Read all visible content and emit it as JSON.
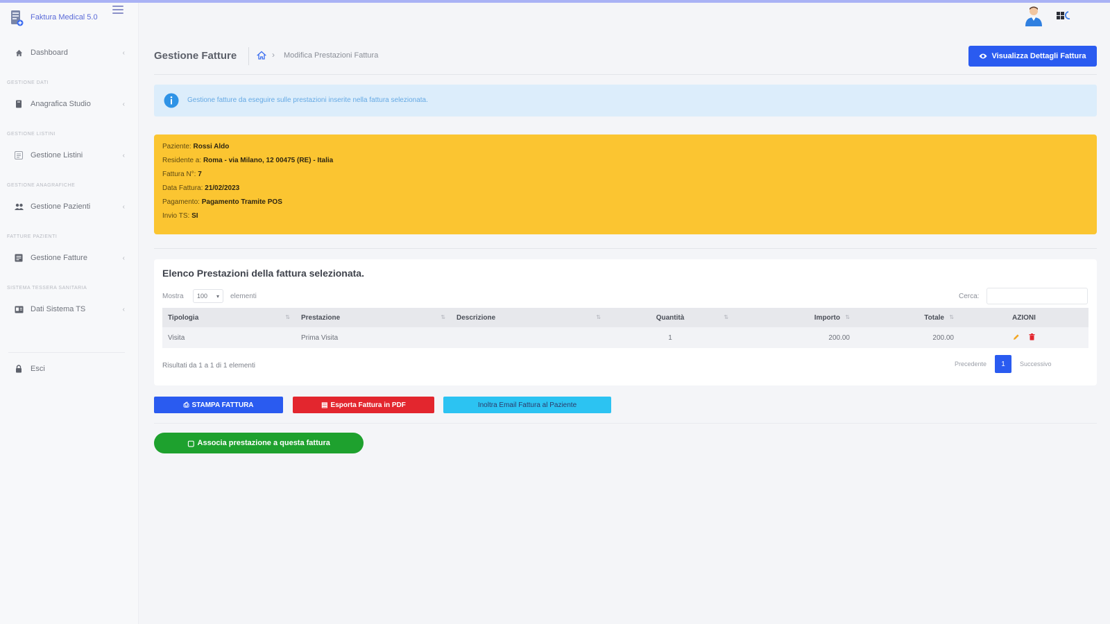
{
  "app": {
    "brand": "Faktura Medical 5.0"
  },
  "sidebar": {
    "dashboard": "Dashboard",
    "sections": [
      {
        "title": "Gestione Dati",
        "item": "Anagrafica Studio"
      },
      {
        "title": "Gestione Listini",
        "item": "Gestione Listini"
      },
      {
        "title": "Gestione Anagrafiche",
        "item": "Gestione Pazienti"
      },
      {
        "title": "Fatture Pazienti",
        "item": "Gestione Fatture"
      },
      {
        "title": "Sistema Tessera Sanitaria",
        "item": "Dati Sistema TS"
      }
    ],
    "exit": "Esci"
  },
  "header": {
    "page_title": "Gestione Fatture",
    "breadcrumb_current": "Modifica Prestazioni Fattura",
    "details_button": "Visualizza Dettagli Fattura"
  },
  "alert": {
    "text": "Gestione fatture da eseguire sulle prestazioni inserite nella fattura selezionata."
  },
  "invoice": {
    "patient_label": "Paziente:",
    "patient_value": "Rossi Aldo",
    "residence_label": "Residente a:",
    "residence_value": "Roma - via Milano, 12 00475 (RE) - Italia",
    "number_label": "Fattura N°:",
    "number_value": "7",
    "date_label": "Data Fattura:",
    "date_value": "21/02/2023",
    "payment_label": "Pagamento:",
    "payment_value": "Pagamento Tramite POS",
    "ts_label": "Invio TS:",
    "ts_value": "SI"
  },
  "table_card": {
    "title": "Elenco Prestazioni della fattura selezionata.",
    "show_label": "Mostra",
    "length_value": "100",
    "elements_label": "elementi",
    "search_label": "Cerca:",
    "columns": [
      "Tipologia",
      "Prestazione",
      "Descrizione",
      "Quantità",
      "Importo",
      "Totale",
      "AZIONI"
    ],
    "rows": [
      {
        "tipologia": "Visita",
        "prestazione": "Prima Visita",
        "descrizione": "",
        "quantita": "1",
        "importo": "200.00",
        "totale": "200.00"
      }
    ],
    "info": "Risultati da 1 a 1 di 1 elementi",
    "pager": {
      "prev": "Precedente",
      "page": "1",
      "next": "Successivo"
    }
  },
  "buttons": {
    "print": "STAMPA FATTURA",
    "pdf": "Esporta Fattura in PDF",
    "email": "Inoltra Email Fattura al Paziente",
    "associate": "Associa prestazione a questa fattura"
  },
  "colors": {
    "primary": "#2a5bf0",
    "warning": "#fbc531",
    "danger": "#e3262e",
    "info": "#2cc3f2",
    "success": "#1ea12e"
  }
}
